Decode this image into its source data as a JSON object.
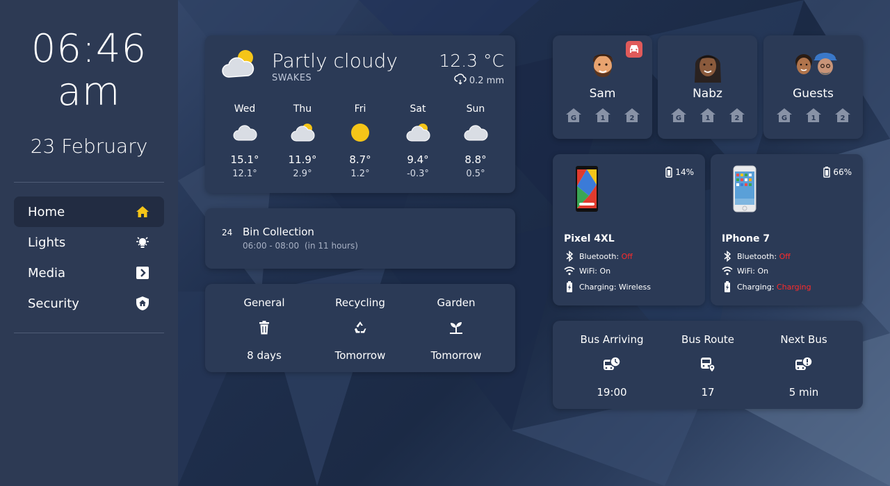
{
  "sidebar": {
    "time_line1": "06:46",
    "time_line2": "am",
    "date": "23 February",
    "nav": [
      {
        "label": "Home",
        "icon": "home-icon",
        "active": true
      },
      {
        "label": "Lights",
        "icon": "lightbulb-icon"
      },
      {
        "label": "Media",
        "icon": "media-icon"
      },
      {
        "label": "Security",
        "icon": "shield-home-icon"
      }
    ]
  },
  "weather": {
    "condition": "Partly cloudy",
    "location": "SWAKES",
    "temperature": "12.3 °C",
    "precipitation": "0.2 mm",
    "forecast": [
      {
        "day": "Wed",
        "icon": "cloudy",
        "high": "15.1°",
        "low": "12.1°"
      },
      {
        "day": "Thu",
        "icon": "partly-cloudy",
        "high": "11.9°",
        "low": "2.9°"
      },
      {
        "day": "Fri",
        "icon": "sunny",
        "high": "8.7°",
        "low": "1.2°"
      },
      {
        "day": "Sat",
        "icon": "partly-cloudy",
        "high": "9.4°",
        "low": "-0.3°"
      },
      {
        "day": "Sun",
        "icon": "cloudy",
        "high": "8.8°",
        "low": "0.5°"
      }
    ]
  },
  "bin_event": {
    "day": "24",
    "title": "Bin Collection",
    "time": "06:00 - 08:00",
    "relative": "(in 11 hours)"
  },
  "bins": [
    {
      "label": "General",
      "icon": "trash-icon",
      "value": "8 days"
    },
    {
      "label": "Recycling",
      "icon": "recycle-icon",
      "value": "Tomorrow"
    },
    {
      "label": "Garden",
      "icon": "sprout-icon",
      "value": "Tomorrow"
    }
  ],
  "people": [
    {
      "name": "Sam",
      "car": true,
      "floors": [
        "G",
        "1",
        "2"
      ]
    },
    {
      "name": "Nabz",
      "car": false,
      "floors": [
        "G",
        "1",
        "2"
      ]
    },
    {
      "name": "Guests",
      "car": false,
      "floors": [
        "G",
        "1",
        "2"
      ]
    }
  ],
  "phones": [
    {
      "name": "Pixel 4XL",
      "battery": "14%",
      "bluetooth_label": "Bluetooth:",
      "bluetooth": "Off",
      "wifi_label": "WiFi:",
      "wifi": "On",
      "charging_label": "Charging:",
      "charging": "Wireless"
    },
    {
      "name": "IPhone 7",
      "battery": "66%",
      "bluetooth_label": "Bluetooth:",
      "bluetooth": "Off",
      "wifi_label": "WiFi:",
      "wifi": "On",
      "charging_label": "Charging:",
      "charging": "Charging"
    }
  ],
  "bus": [
    {
      "label": "Bus Arriving",
      "icon": "bus-clock-icon",
      "value": "19:00"
    },
    {
      "label": "Bus Route",
      "icon": "bus-marker-icon",
      "value": "17"
    },
    {
      "label": "Next Bus",
      "icon": "bus-alert-icon",
      "value": "5 min"
    }
  ],
  "colors": {
    "accent_yellow": "#f5c518",
    "alert_red": "#ff2a2a",
    "card": "#2b3a56",
    "sidebar": "#2d3a54"
  }
}
